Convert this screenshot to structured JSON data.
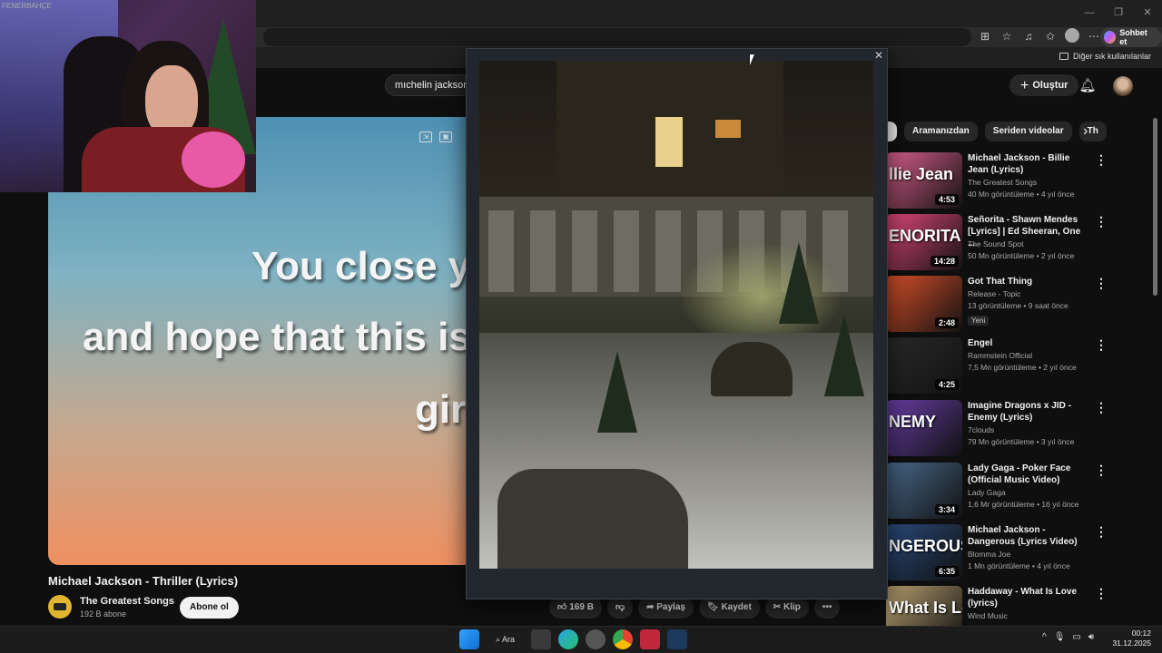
{
  "search": {
    "text": "mıchelin jackson"
  },
  "header": {
    "create_label": "Oluştur"
  },
  "browser": {
    "chat_label": "Sohbet et",
    "bookmarks_label": "Diğer sık kullanılanlar",
    "win_min": "—",
    "win_max": "❐",
    "win_close": "✕"
  },
  "video": {
    "lyrics": [
      "You close y",
      "and hope that this is",
      "gir"
    ],
    "title": "Michael Jackson - Thriller (Lyrics)",
    "channel": "The Greatest Songs",
    "subscribers": "192 B abone",
    "subscribe_label": "Abone ol",
    "actions": {
      "like": "169 B",
      "share": "Paylaş",
      "save": "Kaydet",
      "clip": "Klip",
      "more": "•••"
    }
  },
  "webcam": {
    "logo": "FENERBAHÇE"
  },
  "chips": [
    "Aramanızdan",
    "Seriden videolar",
    "Th"
  ],
  "recommendations": [
    {
      "title": "Michael Jackson - Billie Jean (Lyrics)",
      "thumb_text": "llie Jean",
      "channel": "The Greatest Songs",
      "meta": "40 Mn görüntüleme • 4 yıl önce",
      "duration": "4:53",
      "color": "#d9608c"
    },
    {
      "title": "Señorita - Shawn Mendes [Lyrics] | Ed Sheeran, One ...",
      "thumb_text": "ENORITA",
      "channel": "The Sound Spot",
      "meta": "50 Mn görüntüleme • 2 yıl önce",
      "duration": "14:28",
      "color": "#e0487c"
    },
    {
      "title": "Got That Thing",
      "thumb_text": "",
      "channel": "Release - Topic",
      "meta": "13 görüntüleme • 9 saat önce",
      "duration": "2:48",
      "color": "#d8502a",
      "badge": "Yeni"
    },
    {
      "title": "Engel",
      "thumb_text": "",
      "channel": "Rammstein Official",
      "meta": "7,5 Mn görüntüleme • 2 yıl önce",
      "duration": "4:25",
      "color": "#2a2a2a"
    },
    {
      "title": "Imagine Dragons x JID - Enemy (Lyrics)",
      "thumb_text": "NEMY",
      "channel": "7clouds",
      "meta": "79 Mn görüntüleme • 3 yıl önce",
      "duration": "",
      "color": "#6a3fa8"
    },
    {
      "title": "Lady Gaga - Poker Face (Official Music Video)",
      "thumb_text": "",
      "channel": "Lady Gaga",
      "meta": "1,6 Mr görüntüleme • 16 yıl önce",
      "duration": "3:34",
      "color": "#4a6a8c"
    },
    {
      "title": "Michael Jackson - Dangerous (Lyrics Video)",
      "thumb_text": "NGEROUS",
      "channel": "Blomma Joe",
      "meta": "1 Mn görüntüleme • 4 yıl önce",
      "duration": "6:35",
      "color": "#2a4a7a"
    },
    {
      "title": "Haddaway - What Is Love (lyrics)",
      "thumb_text": "What Is Love",
      "channel": "Wind Music",
      "meta": "",
      "duration": "",
      "color": "#b8a070"
    }
  ],
  "taskbar": {
    "search_label": "Ara",
    "time": "00:12",
    "date": "31.12.2025"
  }
}
